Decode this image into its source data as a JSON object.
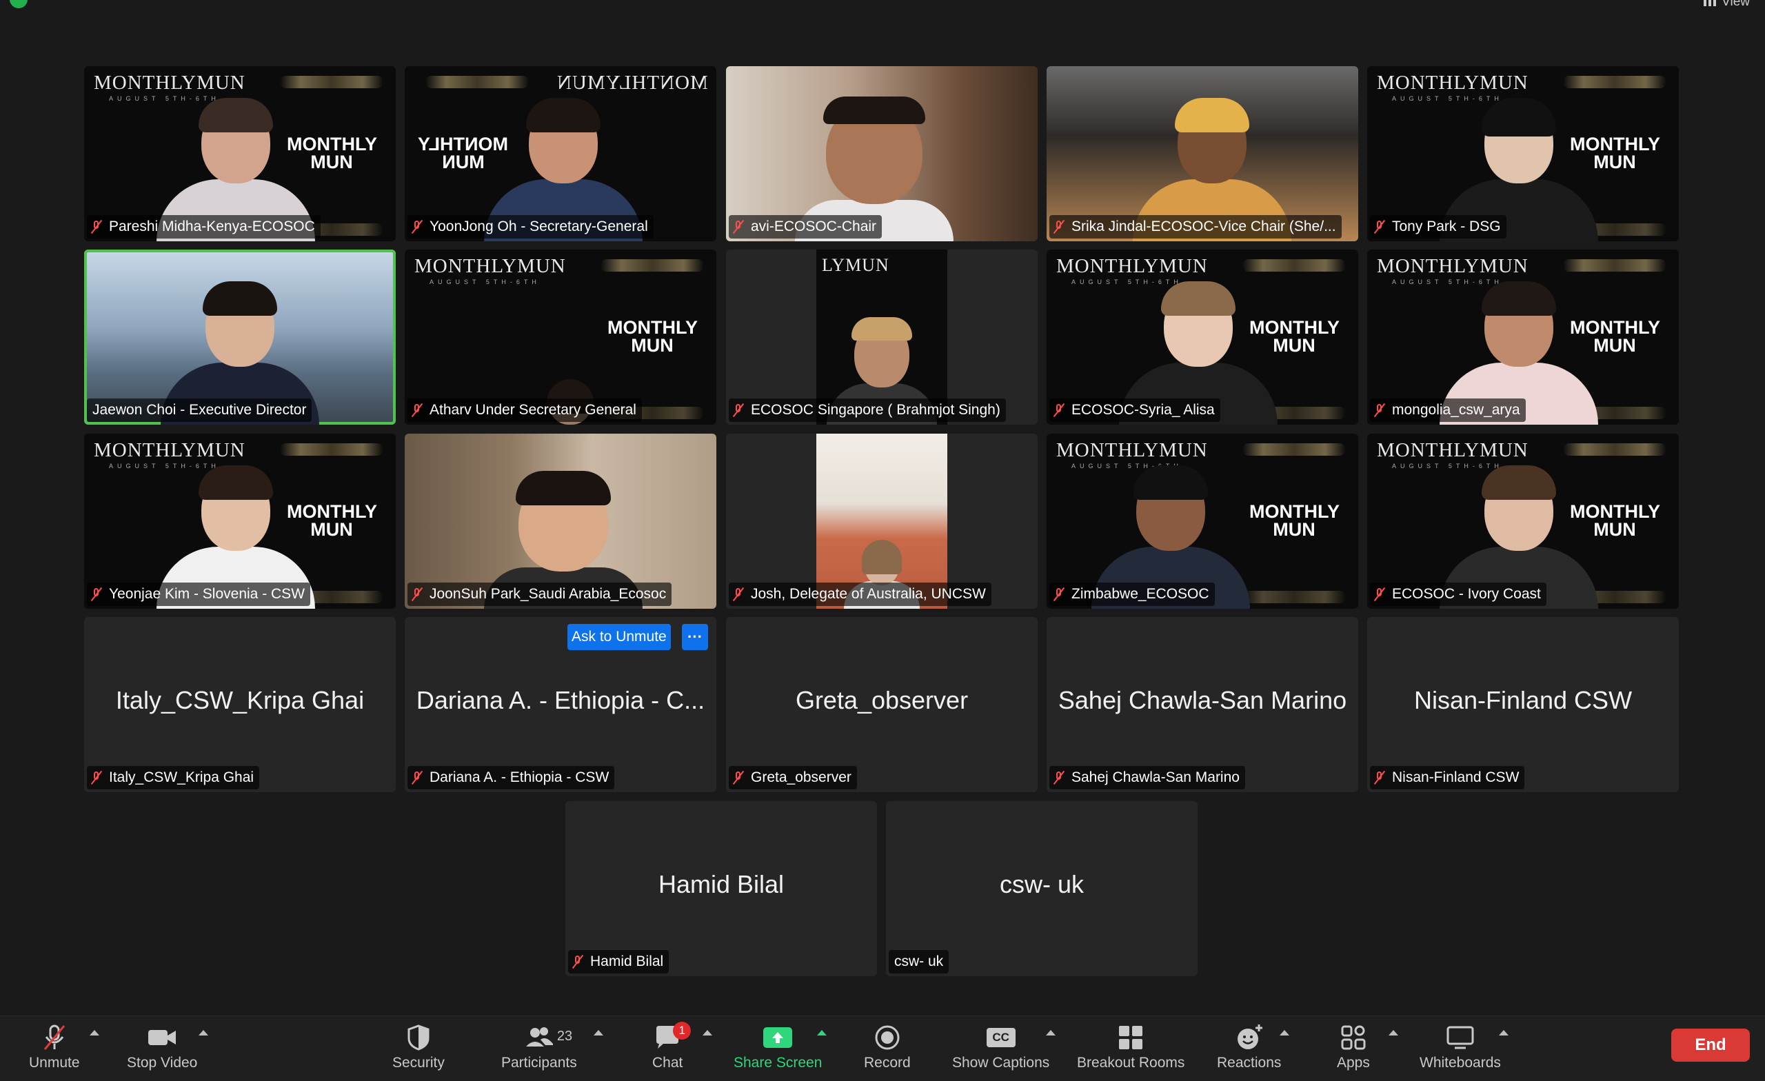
{
  "topbar": {
    "view_label": "View"
  },
  "tiles": [
    {
      "name": "Pareshi Midha-Kenya-ECOSOC",
      "type": "video",
      "brand": "MONTHLYMUN",
      "muted": true
    },
    {
      "name": "YoonJong Oh - Secretary-General",
      "type": "video",
      "brand": "MONTHLYMUN",
      "muted": true
    },
    {
      "name": "avi-ECOSOC-Chair",
      "type": "video",
      "muted": true
    },
    {
      "name": "Srika Jindal-ECOSOC-Vice Chair (She/...",
      "type": "video",
      "muted": true
    },
    {
      "name": "Tony Park - DSG",
      "type": "video",
      "brand": "MONTHLYMUN",
      "muted": true
    },
    {
      "name": "Jaewon Choi - Executive Director",
      "type": "video",
      "active": true,
      "muted": false
    },
    {
      "name": "Atharv Under Secretary General",
      "type": "video",
      "brand": "MONTHLYMUN",
      "muted": true
    },
    {
      "name": "ECOSOC Singapore ( Brahmjot Singh)",
      "type": "video",
      "brand": "LYMUN",
      "muted": true
    },
    {
      "name": "ECOSOC-Syria_ Alisa",
      "type": "video",
      "brand": "MONTHLYMUN",
      "muted": true
    },
    {
      "name": "mongolia_csw_arya",
      "type": "video",
      "brand": "MONTHLYMUN",
      "muted": true
    },
    {
      "name": "Yeonjae Kim - Slovenia - CSW",
      "type": "video",
      "brand": "MONTHLYMUN",
      "muted": true
    },
    {
      "name": "JoonSuh Park_Saudi Arabia_Ecosoc",
      "type": "video",
      "muted": true
    },
    {
      "name": "Josh, Delegate of Australia, UNCSW",
      "type": "video",
      "muted": true
    },
    {
      "name": "Zimbabwe_ECOSOC",
      "type": "video",
      "brand": "MONTHLYMUN",
      "muted": true
    },
    {
      "name": "ECOSOC - Ivory Coast",
      "type": "video",
      "brand": "MONTHLYMUN",
      "muted": true
    },
    {
      "name": "Italy_CSW_Kripa Ghai",
      "display": "Italy_CSW_Kripa Ghai",
      "type": "audio",
      "muted": true
    },
    {
      "name": "Dariana A. - Ethiopia - CSW",
      "display": "Dariana A. - Ethiopia - C...",
      "type": "audio",
      "muted": true
    },
    {
      "name": "Greta_observer",
      "display": "Greta_observer",
      "type": "audio",
      "muted": true
    },
    {
      "name": "Sahej Chawla-San Marino",
      "display": "Sahej Chawla-San Marino",
      "type": "audio",
      "muted": true
    },
    {
      "name": "Nisan-Finland CSW",
      "display": "Nisan-Finland CSW",
      "type": "audio",
      "muted": true
    },
    {
      "name": "Hamid Bilal",
      "display": "Hamid Bilal",
      "type": "audio",
      "muted": true
    },
    {
      "name": "csw- uk",
      "display": "csw- uk",
      "type": "audio",
      "muted": false
    }
  ],
  "hover_controls": {
    "ask_to_unmute": "Ask to Unmute",
    "more": "···"
  },
  "logo_text": "MONTHLY MUN",
  "toolbar": {
    "unmute": "Unmute",
    "stop_video": "Stop Video",
    "security": "Security",
    "participants": "Participants",
    "participants_count": "23",
    "chat": "Chat",
    "chat_badge": "1",
    "share_screen": "Share Screen",
    "record": "Record",
    "show_captions": "Show Captions",
    "captions_icon": "CC",
    "breakout_rooms": "Breakout Rooms",
    "reactions": "Reactions",
    "apps": "Apps",
    "whiteboards": "Whiteboards",
    "end": "End"
  },
  "colors": {
    "accent": "#0e72ed",
    "active_speaker": "#52c24e",
    "end": "#d93a36",
    "muted": "#ff4d4d",
    "share": "#2fd67c"
  }
}
